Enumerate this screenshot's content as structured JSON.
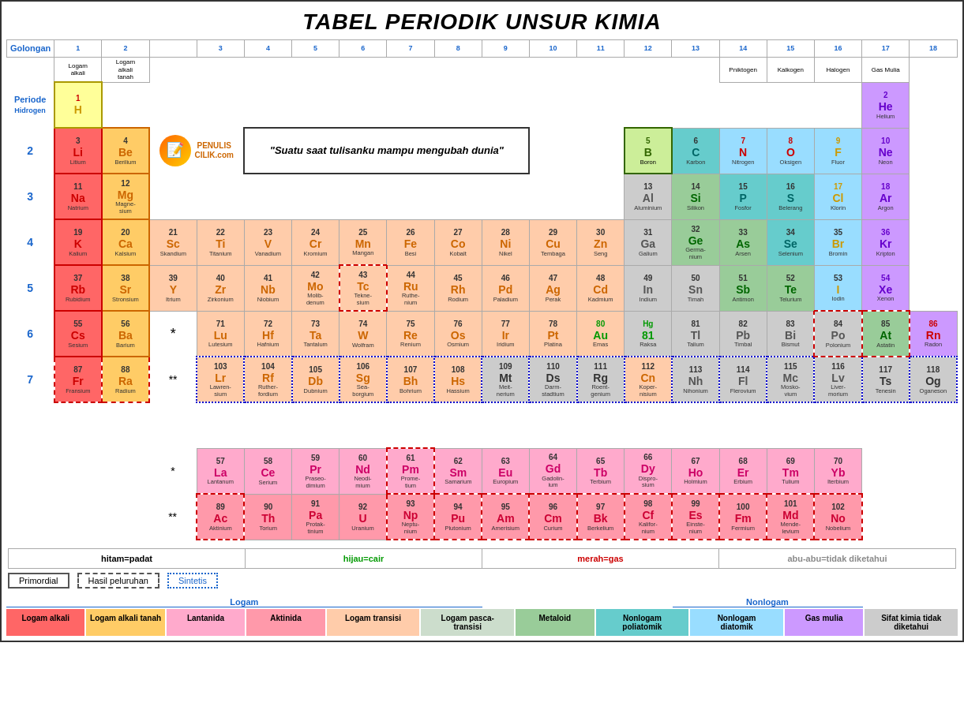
{
  "title": "TABEL PERIODIK UNSUR KIMIA",
  "header": {
    "golongan": "Golongan",
    "periode": "Periode"
  },
  "column_numbers": [
    "1",
    "2",
    "",
    "3",
    "4",
    "5",
    "6",
    "7",
    "8",
    "9",
    "10",
    "11",
    "12",
    "13",
    "14",
    "15",
    "16",
    "17",
    "18"
  ],
  "column_groups": {
    "1": "Logam alkali",
    "2": "Logam alkali tanah",
    "15": "Pniktogen",
    "16": "Kalkogen",
    "17": "Halogen",
    "18": "Gas Mulia"
  },
  "elements": {
    "H": {
      "number": 1,
      "symbol": "H",
      "name": "Hidrogen",
      "period": 1,
      "group": 1
    },
    "He": {
      "number": 2,
      "symbol": "He",
      "name": "Helium",
      "period": 1,
      "group": 18
    },
    "Li": {
      "number": 3,
      "symbol": "Li",
      "name": "Litium",
      "period": 2,
      "group": 1
    },
    "Be": {
      "number": 4,
      "symbol": "Be",
      "name": "Berilium",
      "period": 2,
      "group": 2
    },
    "B": {
      "number": 5,
      "symbol": "B",
      "name": "Boron",
      "period": 2,
      "group": 13
    },
    "C": {
      "number": 6,
      "symbol": "C",
      "name": "Karbon",
      "period": 2,
      "group": 14
    },
    "N": {
      "number": 7,
      "symbol": "N",
      "name": "Nitrogen",
      "period": 2,
      "group": 15
    },
    "O": {
      "number": 8,
      "symbol": "O",
      "name": "Oksigen",
      "period": 2,
      "group": 16
    },
    "F": {
      "number": 9,
      "symbol": "F",
      "name": "Fluor",
      "period": 2,
      "group": 17
    },
    "Ne": {
      "number": 10,
      "symbol": "Ne",
      "name": "Neon",
      "period": 2,
      "group": 18
    }
  },
  "quote": "\"Suatu saat tulisanku mampu mengubah dunia\"",
  "legend": {
    "solid": "hitam=padat",
    "liquid": "hijau=cair",
    "gas": "merah=gas",
    "unknown": "abu-abu=tidak diketahui",
    "primordial": "Primordial",
    "decay": "Hasil peluruhan",
    "synthetic": "Sintetis"
  },
  "categories": [
    {
      "label": "Logam alkali",
      "color": "#ff6666"
    },
    {
      "label": "Logam alkali tanah",
      "color": "#ffcc66"
    },
    {
      "label": "Lantanida",
      "color": "#ffaacc"
    },
    {
      "label": "Aktinida",
      "color": "#ff99aa"
    },
    {
      "label": "Logam transisi",
      "color": "#ffccaa"
    },
    {
      "label": "Logam pasca-transisi",
      "color": "#ccddcc"
    },
    {
      "label": "Metaloid",
      "color": "#99cc99"
    },
    {
      "label": "Nonlogam poliatomik",
      "color": "#66cccc"
    },
    {
      "label": "Nonlogam diatomik",
      "color": "#99ddff"
    },
    {
      "label": "Gas mulia",
      "color": "#cc99ff"
    },
    {
      "label": "Sifat kimia tidak diketahui",
      "color": "#cccccc"
    }
  ]
}
